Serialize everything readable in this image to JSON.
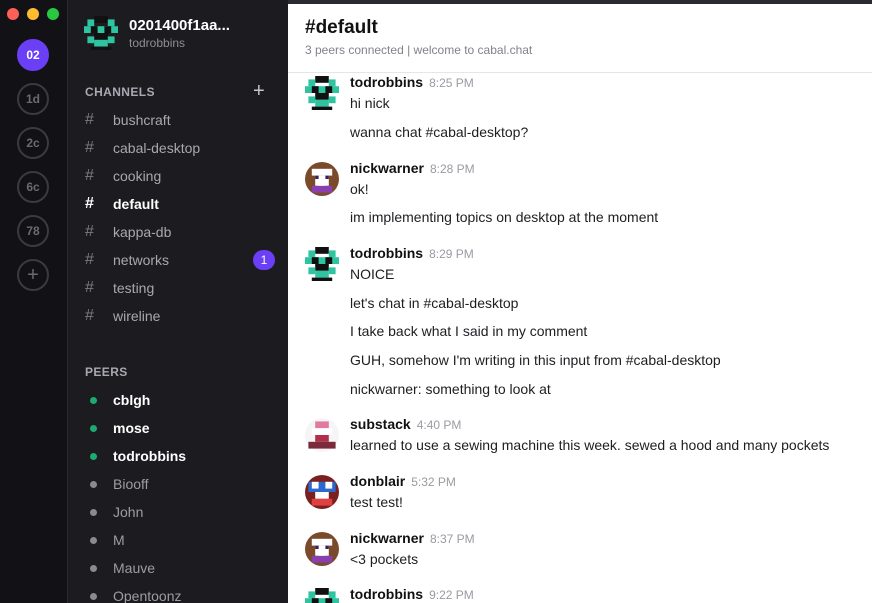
{
  "window": {
    "controls": [
      "close",
      "minimize",
      "maximize"
    ]
  },
  "cabals": [
    {
      "label": "02",
      "active": true
    },
    {
      "label": "1d"
    },
    {
      "label": "2c"
    },
    {
      "label": "6c"
    },
    {
      "label": "78"
    }
  ],
  "add_cabal_icon": "plus-icon",
  "profile": {
    "name": "0201400f1aa...",
    "username": "todrobbins"
  },
  "channels_section": {
    "title": "CHANNELS",
    "add_icon": "plus-icon"
  },
  "channels": [
    {
      "name": "bushcraft"
    },
    {
      "name": "cabal-desktop"
    },
    {
      "name": "cooking"
    },
    {
      "name": "default",
      "selected": true
    },
    {
      "name": "kappa-db"
    },
    {
      "name": "networks",
      "unread": "1"
    },
    {
      "name": "testing"
    },
    {
      "name": "wireline"
    }
  ],
  "peers_section": {
    "title": "PEERS"
  },
  "peers": [
    {
      "name": "cblgh",
      "online": true
    },
    {
      "name": "mose",
      "online": true
    },
    {
      "name": "todrobbins",
      "online": true
    },
    {
      "name": "Biooff"
    },
    {
      "name": "John"
    },
    {
      "name": "M"
    },
    {
      "name": "Mauve"
    },
    {
      "name": "Opentoonz"
    }
  ],
  "header": {
    "title": "#default",
    "topic": "3 peers connected | welcome to cabal.chat"
  },
  "messages": [
    {
      "author": "todrobbins",
      "time": "8:25 PM",
      "lines": [
        "hi nick",
        "wanna chat #cabal-desktop?"
      ]
    },
    {
      "author": "nickwarner",
      "time": "8:28 PM",
      "lines": [
        "ok!",
        "im implementing topics on desktop at the moment"
      ]
    },
    {
      "author": "todrobbins",
      "time": "8:29 PM",
      "lines": [
        "NOICE",
        "let's chat in #cabal-desktop",
        "I take back what I said in my comment",
        "GUH, somehow I'm writing in this input from #cabal-desktop",
        "nickwarner: something to look at"
      ]
    },
    {
      "author": "substack",
      "time": "4:40 PM",
      "lines": [
        "learned to use a sewing machine this week. sewed a hood and many pockets"
      ]
    },
    {
      "author": "donblair",
      "time": "5:32 PM",
      "lines": [
        "test test!"
      ]
    },
    {
      "author": "nickwarner",
      "time": "8:37 PM",
      "lines": [
        "<3 pockets"
      ]
    },
    {
      "author": "todrobbins",
      "time": "9:22 PM",
      "lines": []
    }
  ],
  "colors": {
    "accent": "#6b3ff5",
    "online": "#1dab72",
    "sidebar": "#1b1b20",
    "rail": "#111116"
  }
}
